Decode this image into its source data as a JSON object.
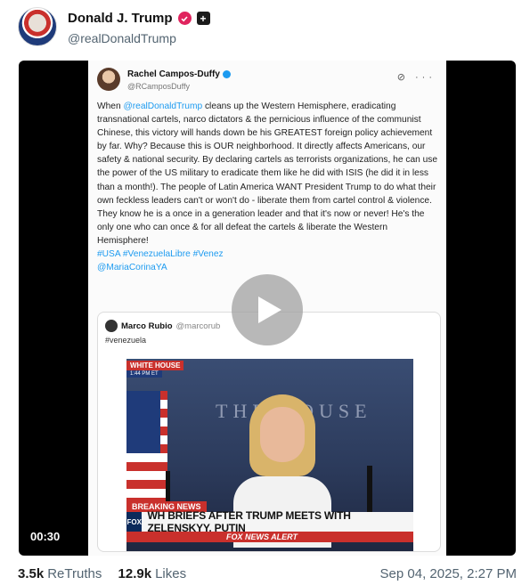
{
  "author": {
    "display_name": "Donald J. Trump",
    "handle": "@realDonaldTrump",
    "avatar_icon": "profile-photo",
    "verified_icon": "verified-badge-icon",
    "plus_icon": "plus-icon"
  },
  "video": {
    "duration": "00:30",
    "play_icon": "play-icon",
    "embedded_post": {
      "author_name": "Rachel Campos-Duffy",
      "author_handle": "@RCamposDuffy",
      "text_mention": "@realDonaldTrump",
      "text_body": " cleans up the Western Hemisphere, eradicating transnational cartels, narco dictators & the pernicious influence of the communist Chinese, this victory will hands down be his GREATEST foreign policy achievement by far. Why? Because this is OUR neighborhood. It directly affects Americans, our safety & national security. By declaring cartels as terrorists organizations, he can use the power of the US military to eradicate them like he did with ISIS (he did it in less than a month!). The people of Latin America WANT President Trump to do what their own feckless leaders can't or won't do - liberate them from cartel control & violence. They know he is a once in a generation leader and that it's now or never! He's the only one who can once & for all defeat the cartels & liberate the Western Hemisphere!",
      "hashtags": "#USA #VenezuelaLibre #Venez",
      "mention_2": "@MariaCorinaYA",
      "quoted": {
        "author_name": "Marco Rubio",
        "author_handle": "@marcorub",
        "tag": "#venezuela",
        "broadcast": {
          "wh_logo": "WHITE HOUSE",
          "wh_time": "1:44 PM ET",
          "backdrop_text": "THE HOUSE",
          "breaking": "BREAKING NEWS",
          "network": "FOX",
          "headline": "WH BRIEFS AFTER TRUMP MEETS WITH ZELENSKYY, PUTIN",
          "ticker": "FOX NEWS ALERT"
        }
      }
    }
  },
  "footer": {
    "retruths_count": "3.5k",
    "retruths_label": "ReTruths",
    "likes_count": "12.9k",
    "likes_label": "Likes",
    "timestamp": "Sep 04, 2025, 2:27 PM"
  },
  "colors": {
    "accent_link": "#1d9bf0",
    "verified_badge": "#e0245e",
    "breaking_red": "#c9302c"
  }
}
